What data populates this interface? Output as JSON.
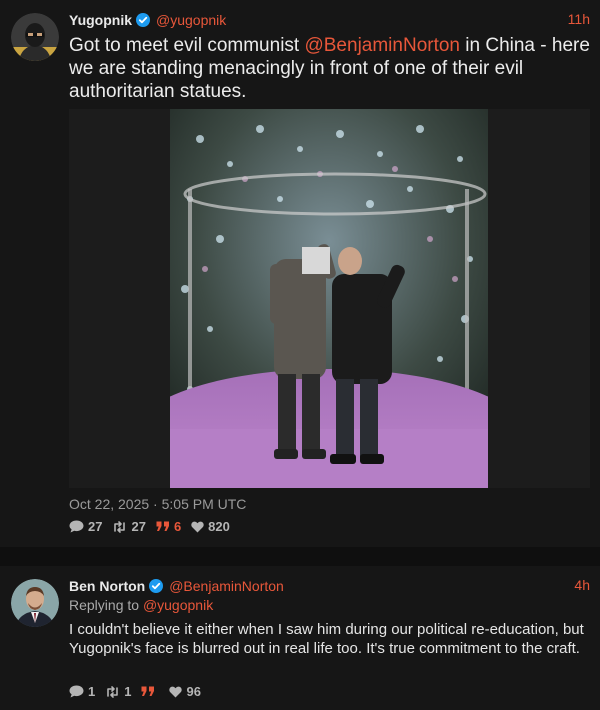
{
  "tweets": [
    {
      "author": {
        "name": "Yugopnik",
        "handle": "@yugopnik",
        "verified": true
      },
      "time": "11h",
      "text_before": "Got to meet evil communist ",
      "mention": "@BenjaminNorton",
      "text_after": " in China - here we are standing menacingly in front of one of their evil authoritarian statues.",
      "date": "Oct 22, 2025 · 5:05 PM UTC",
      "stats": {
        "replies": "27",
        "retweets": "27",
        "quotes": "6",
        "likes": "820"
      }
    },
    {
      "author": {
        "name": "Ben Norton",
        "handle": "@BenjaminNorton",
        "verified": true
      },
      "time": "4h",
      "replying_prefix": "Replying to ",
      "replying_to": "@yugopnik",
      "text": "I couldn't believe it either when I saw him during our political re-education, but Yugopnik's face is blurred out in real life too. It's true commitment to the craft.",
      "stats": {
        "replies": "1",
        "retweets": "1",
        "quotes": "",
        "likes": "96"
      }
    }
  ],
  "icons": {
    "reply": "speech-bubble-icon",
    "retweet": "retweet-arrows-icon",
    "quote": "quote-marks-icon",
    "like": "heart-icon",
    "verified": "verified-check-icon"
  },
  "colors": {
    "accent": "#e8573a",
    "verified": "#1d9bf0",
    "background": "#161616"
  }
}
